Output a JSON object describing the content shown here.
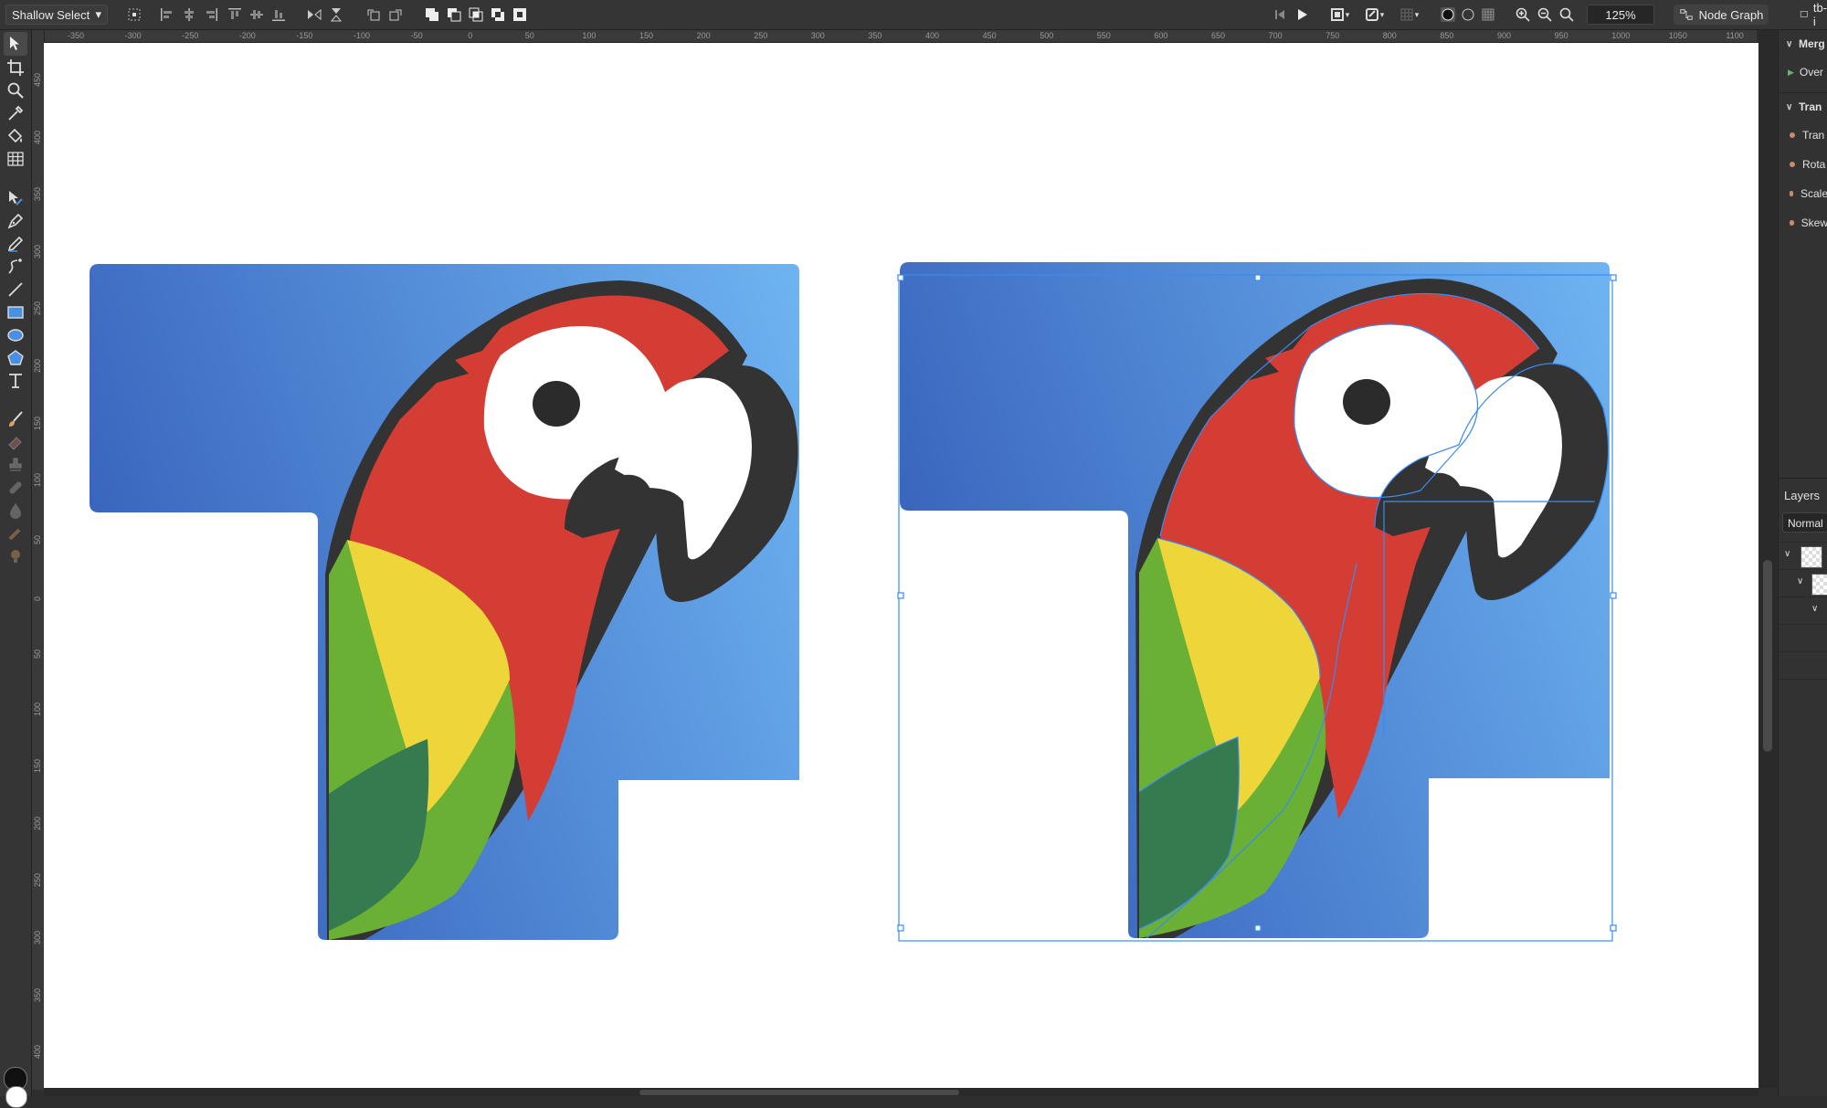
{
  "toolbar": {
    "tool_mode": "Shallow Select",
    "zoom": "125%",
    "node_graph": "Node Graph",
    "doc_tab": "tb-i"
  },
  "ruler": {
    "horizontal": [
      "-350",
      "-300",
      "-250",
      "-200",
      "-150",
      "-100",
      "-50",
      "0",
      "50",
      "100",
      "150",
      "200",
      "250",
      "300",
      "350",
      "400",
      "450",
      "500",
      "550",
      "600",
      "650",
      "700",
      "750",
      "800",
      "850",
      "900",
      "950",
      "1000",
      "1050",
      "1100"
    ],
    "vertical": [
      "450",
      "400",
      "350",
      "300",
      "250",
      "200",
      "150",
      "100",
      "50",
      "0",
      "50",
      "100",
      "150",
      "200",
      "250",
      "300",
      "350",
      "400"
    ]
  },
  "panel": {
    "merge_title": "Merg",
    "overlay_label": "Over",
    "transform_title": "Tran",
    "transform_items": [
      "Tran",
      "Rota",
      "Scale",
      "Skew"
    ],
    "layers_title": "Layers",
    "blend_mode": "Normal"
  },
  "artwork": {
    "background_blue_dark": "#3a66be",
    "background_blue_light": "#6eb4f2",
    "red": "#d43d34",
    "yellow": "#eed63a",
    "green": "#6ab035",
    "dark_green": "#367b4f",
    "outline": "#333333",
    "selection_color": "#3a8bf0"
  },
  "colors": {
    "chrome_bg": "#353535",
    "canvas_bg": "#ffffff",
    "foreground_swatch": "#111111",
    "background_swatch": "#ffffff"
  }
}
